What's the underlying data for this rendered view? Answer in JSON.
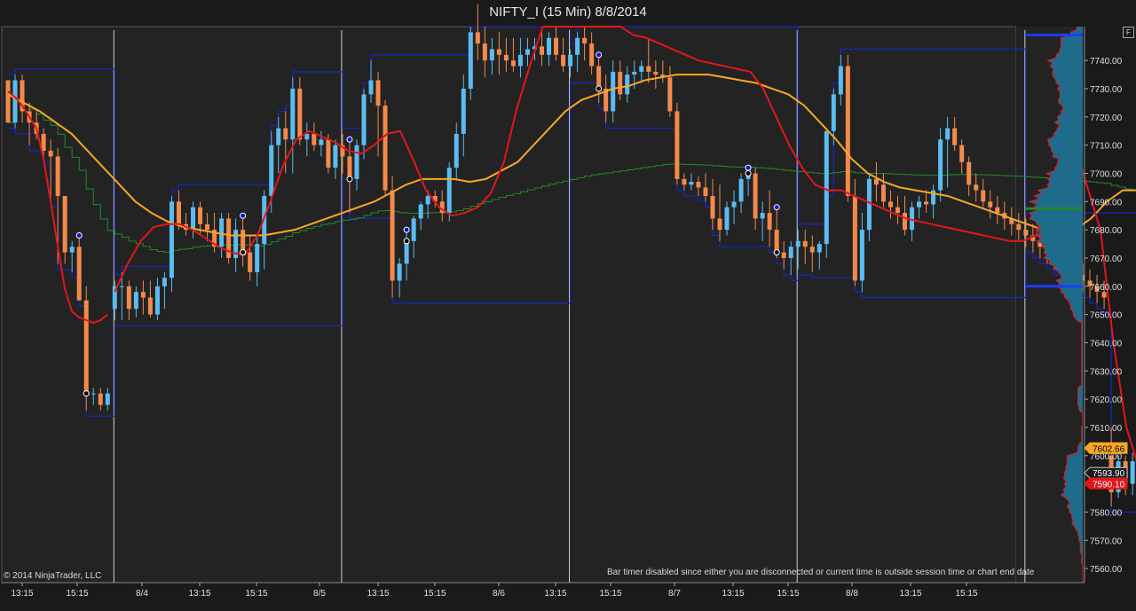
{
  "title": "NIFTY_I (15 Min)  8/8/2014",
  "f_button": "F",
  "copyright": "© 2014 NinjaTrader, LLC",
  "bar_timer_msg": "Bar timer disabled since either you are disconnected or current time is outside session time or chart end date",
  "colors": {
    "background": "#232323",
    "up_candle": "#5cbcf2",
    "down_candle": "#f48a4a",
    "ema_fast": "#e3161b",
    "ema_slow": "#f7a823",
    "vwap": "#1f8c28",
    "channel": "#1727b6",
    "session_line": "#ffffff",
    "profile": "#1f6b8c",
    "profile_edge": "#e3161b"
  },
  "chart_data": {
    "type": "candlestick",
    "title": "NIFTY_I (15 Min)  8/8/2014",
    "ylim": [
      7555,
      7752
    ],
    "y_ticks": [
      "7740.00",
      "7730.00",
      "7720.00",
      "7710.00",
      "7700.00",
      "7690.00",
      "7680.00",
      "7670.00",
      "7660.00",
      "7650.00",
      "7640.00",
      "7630.00",
      "7620.00",
      "7610.00",
      "7600.00",
      "7590.00",
      "7580.00",
      "7570.00",
      "7560.00"
    ],
    "x_ticks": [
      "13:15",
      "15:15",
      "8/4",
      "13:15",
      "15:15",
      "8/5",
      "13:15",
      "15:15",
      "8/6",
      "13:15",
      "15:15",
      "8/7",
      "13:15",
      "15:15",
      "8/8",
      "13:15",
      "15:15"
    ],
    "price_labels": [
      {
        "text": "7602.66",
        "value": 7602.66,
        "color": "#f7a823"
      },
      {
        "text": "7593.90",
        "value": 7593.9,
        "color": "#1a1a1a"
      },
      {
        "text": "7590.10",
        "value": 7590.1,
        "color": "#e3161b"
      }
    ],
    "session_starts": [
      15,
      47,
      79,
      111,
      143
    ],
    "candles": [
      [
        7733,
        7733,
        7718,
        7718
      ],
      [
        7718,
        7735,
        7716,
        7733
      ],
      [
        7733,
        7735,
        7718,
        7722
      ],
      [
        7722,
        7725,
        7710,
        7718
      ],
      [
        7718,
        7722,
        7712,
        7714
      ],
      [
        7714,
        7716,
        7706,
        7708
      ],
      [
        7708,
        7712,
        7690,
        7706
      ],
      [
        7706,
        7709,
        7668,
        7692
      ],
      [
        7692,
        7692,
        7668,
        7672
      ],
      [
        7672,
        7676,
        7665,
        7674
      ],
      [
        7674,
        7678,
        7655,
        7655
      ],
      [
        7655,
        7660,
        7616,
        7622
      ],
      [
        7622,
        7624,
        7618,
        7622
      ],
      [
        7622,
        7624,
        7616,
        7618
      ],
      [
        7618,
        7624,
        7616,
        7622
      ],
      [
        7652,
        7662,
        7648,
        7660
      ],
      [
        7660,
        7665,
        7648,
        7660
      ],
      [
        7660,
        7662,
        7648,
        7652
      ],
      [
        7652,
        7660,
        7649,
        7658
      ],
      [
        7658,
        7662,
        7650,
        7656
      ],
      [
        7656,
        7662,
        7649,
        7650
      ],
      [
        7650,
        7663,
        7648,
        7660
      ],
      [
        7660,
        7665,
        7652,
        7663
      ],
      [
        7663,
        7692,
        7658,
        7690
      ],
      [
        7690,
        7694,
        7680,
        7682
      ],
      [
        7682,
        7686,
        7678,
        7680
      ],
      [
        7680,
        7690,
        7677,
        7688
      ],
      [
        7688,
        7690,
        7678,
        7682
      ],
      [
        7682,
        7686,
        7676,
        7680
      ],
      [
        7680,
        7686,
        7672,
        7674
      ],
      [
        7674,
        7686,
        7670,
        7684
      ],
      [
        7684,
        7686,
        7668,
        7670
      ],
      [
        7670,
        7684,
        7665,
        7680
      ],
      [
        7680,
        7685,
        7667,
        7672
      ],
      [
        7672,
        7678,
        7662,
        7665
      ],
      [
        7665,
        7678,
        7660,
        7675
      ],
      [
        7675,
        7694,
        7666,
        7692
      ],
      [
        7692,
        7715,
        7686,
        7710
      ],
      [
        7710,
        7720,
        7700,
        7716
      ],
      [
        7716,
        7722,
        7700,
        7712
      ],
      [
        7712,
        7734,
        7700,
        7730
      ],
      [
        7730,
        7734,
        7710,
        7712
      ],
      [
        7712,
        7718,
        7706,
        7714
      ],
      [
        7714,
        7718,
        7708,
        7710
      ],
      [
        7710,
        7715,
        7706,
        7712
      ],
      [
        7712,
        7714,
        7700,
        7702
      ],
      [
        7702,
        7712,
        7698,
        7710
      ],
      [
        7710,
        7714,
        7700,
        7706
      ],
      [
        7706,
        7712,
        7686,
        7698
      ],
      [
        7698,
        7712,
        7694,
        7710
      ],
      [
        7710,
        7730,
        7705,
        7728
      ],
      [
        7728,
        7740,
        7725,
        7733
      ],
      [
        7733,
        7736,
        7706,
        7724
      ],
      [
        7724,
        7726,
        7692,
        7694
      ],
      [
        7694,
        7699,
        7656,
        7662
      ],
      [
        7662,
        7670,
        7656,
        7668
      ],
      [
        7668,
        7680,
        7662,
        7676
      ],
      [
        7676,
        7685,
        7670,
        7684
      ],
      [
        7684,
        7690,
        7680,
        7689
      ],
      [
        7689,
        7694,
        7684,
        7692
      ],
      [
        7692,
        7694,
        7688,
        7690
      ],
      [
        7690,
        7694,
        7683,
        7686
      ],
      [
        7686,
        7704,
        7683,
        7702
      ],
      [
        7702,
        7718,
        7698,
        7714
      ],
      [
        7714,
        7735,
        7706,
        7730
      ],
      [
        7730,
        7752,
        7726,
        7750
      ],
      [
        7750,
        7760,
        7740,
        7746
      ],
      [
        7746,
        7752,
        7734,
        7740
      ],
      [
        7740,
        7748,
        7735,
        7744
      ],
      [
        7744,
        7750,
        7735,
        7742
      ],
      [
        7742,
        7748,
        7736,
        7740
      ],
      [
        7740,
        7748,
        7736,
        7738
      ],
      [
        7738,
        7748,
        7734,
        7742
      ],
      [
        7742,
        7748,
        7738,
        7744
      ],
      [
        7744,
        7748,
        7740,
        7745
      ],
      [
        7745,
        7750,
        7738,
        7742
      ],
      [
        7742,
        7750,
        7738,
        7748
      ],
      [
        7748,
        7752,
        7740,
        7742
      ],
      [
        7742,
        7748,
        7736,
        7738
      ],
      [
        7738,
        7744,
        7734,
        7742
      ],
      [
        7742,
        7750,
        7736,
        7748
      ],
      [
        7748,
        7752,
        7740,
        7746
      ],
      [
        7746,
        7750,
        7735,
        7738
      ],
      [
        7738,
        7742,
        7725,
        7730
      ],
      [
        7730,
        7735,
        7718,
        7722
      ],
      [
        7722,
        7740,
        7718,
        7736
      ],
      [
        7736,
        7740,
        7726,
        7728
      ],
      [
        7728,
        7738,
        7725,
        7735
      ],
      [
        7735,
        7740,
        7730,
        7736
      ],
      [
        7736,
        7740,
        7732,
        7738
      ],
      [
        7738,
        7748,
        7732,
        7736
      ],
      [
        7736,
        7740,
        7730,
        7735
      ],
      [
        7735,
        7740,
        7732,
        7734
      ],
      [
        7734,
        7738,
        7720,
        7722
      ],
      [
        7722,
        7725,
        7696,
        7698
      ],
      [
        7698,
        7700,
        7694,
        7696
      ],
      [
        7696,
        7700,
        7694,
        7697
      ],
      [
        7697,
        7699,
        7692,
        7695
      ],
      [
        7695,
        7700,
        7690,
        7692
      ],
      [
        7692,
        7698,
        7680,
        7684
      ],
      [
        7684,
        7696,
        7676,
        7680
      ],
      [
        7680,
        7690,
        7678,
        7688
      ],
      [
        7688,
        7694,
        7682,
        7690
      ],
      [
        7690,
        7700,
        7686,
        7698
      ],
      [
        7698,
        7702,
        7692,
        7700
      ],
      [
        7700,
        7702,
        7680,
        7684
      ],
      [
        7684,
        7690,
        7676,
        7686
      ],
      [
        7686,
        7694,
        7674,
        7680
      ],
      [
        7680,
        7688,
        7670,
        7672
      ],
      [
        7672,
        7676,
        7666,
        7670
      ],
      [
        7670,
        7676,
        7664,
        7674
      ],
      [
        7674,
        7680,
        7666,
        7676
      ],
      [
        7676,
        7680,
        7668,
        7674
      ],
      [
        7674,
        7678,
        7665,
        7672
      ],
      [
        7672,
        7676,
        7666,
        7675
      ],
      [
        7675,
        7690,
        7670,
        7715
      ],
      [
        7715,
        7730,
        7710,
        7728
      ],
      [
        7728,
        7742,
        7724,
        7738
      ],
      [
        7738,
        7742,
        7690,
        7692
      ],
      [
        7692,
        7698,
        7660,
        7662
      ],
      [
        7662,
        7686,
        7658,
        7680
      ],
      [
        7680,
        7700,
        7676,
        7698
      ],
      [
        7698,
        7704,
        7690,
        7696
      ],
      [
        7696,
        7700,
        7688,
        7690
      ],
      [
        7690,
        7694,
        7684,
        7688
      ],
      [
        7688,
        7692,
        7682,
        7686
      ],
      [
        7686,
        7692,
        7678,
        7680
      ],
      [
        7680,
        7690,
        7676,
        7688
      ],
      [
        7688,
        7692,
        7684,
        7690
      ],
      [
        7690,
        7694,
        7686,
        7689
      ],
      [
        7689,
        7696,
        7684,
        7694
      ],
      [
        7694,
        7716,
        7690,
        7712
      ],
      [
        7712,
        7720,
        7695,
        7716
      ],
      [
        7716,
        7720,
        7708,
        7710
      ],
      [
        7710,
        7712,
        7700,
        7704
      ],
      [
        7704,
        7706,
        7692,
        7696
      ],
      [
        7696,
        7700,
        7690,
        7694
      ],
      [
        7694,
        7698,
        7688,
        7690
      ],
      [
        7690,
        7694,
        7684,
        7688
      ],
      [
        7688,
        7692,
        7682,
        7686
      ],
      [
        7686,
        7690,
        7680,
        7684
      ],
      [
        7684,
        7688,
        7678,
        7682
      ],
      [
        7682,
        7686,
        7676,
        7680
      ],
      [
        7680,
        7684,
        7674,
        7678
      ],
      [
        7678,
        7682,
        7672,
        7676
      ],
      [
        7676,
        7680,
        7670,
        7674
      ],
      [
        7674,
        7678,
        7668,
        7672
      ],
      [
        7672,
        7676,
        7666,
        7670
      ],
      [
        7670,
        7674,
        7664,
        7668
      ],
      [
        7668,
        7672,
        7662,
        7666
      ],
      [
        7666,
        7670,
        7660,
        7664
      ],
      [
        7664,
        7668,
        7658,
        7662
      ],
      [
        7662,
        7666,
        7656,
        7660
      ],
      [
        7660,
        7664,
        7654,
        7658
      ],
      [
        7658,
        7662,
        7652,
        7656
      ],
      [
        7600,
        7610,
        7582,
        7587
      ],
      [
        7587,
        7600,
        7585,
        7598
      ],
      [
        7598,
        7600,
        7586,
        7590
      ],
      [
        7590,
        7601,
        7586,
        7598
      ],
      [
        7598,
        7600,
        7584,
        7588
      ],
      [
        7588,
        7600,
        7586,
        7598
      ],
      [
        7598,
        7604,
        7592,
        7595
      ],
      [
        7595,
        7603,
        7590,
        7600
      ],
      [
        7600,
        7604,
        7592,
        7596
      ],
      [
        7596,
        7600,
        7585,
        7588
      ],
      [
        7588,
        7592,
        7576,
        7580
      ],
      [
        7580,
        7588,
        7575,
        7584
      ],
      [
        7584,
        7590,
        7578,
        7582
      ],
      [
        7582,
        7586,
        7574,
        7577
      ],
      [
        7577,
        7582,
        7572,
        7580
      ],
      [
        7580,
        7586,
        7574,
        7584
      ],
      [
        7584,
        7588,
        7576,
        7578
      ],
      [
        7578,
        7582,
        7566,
        7570
      ],
      [
        7570,
        7576,
        7562,
        7574
      ],
      [
        7574,
        7586,
        7570,
        7584
      ],
      [
        7584,
        7594,
        7580,
        7592
      ],
      [
        7592,
        7600,
        7588,
        7596
      ],
      [
        7596,
        7600,
        7582,
        7586
      ],
      [
        7586,
        7596,
        7580,
        7594
      ],
      [
        7594,
        7600,
        7586,
        7590
      ]
    ],
    "ema_fast": [
      [
        7729,
        7727,
        7724,
        7720,
        7716,
        7705,
        7690,
        7674,
        7659,
        7651,
        7649,
        7648,
        7647,
        7648,
        7650
      ],
      [
        7658,
        7668,
        7676,
        7681,
        7682,
        7682,
        7680,
        7677,
        7674,
        7672,
        7671,
        7678,
        7690,
        7703,
        7712,
        7715,
        7713,
        7711,
        7708,
        7707,
        7710,
        7714,
        7715,
        7705,
        7694,
        7688,
        7685,
        7686,
        7688,
        7693,
        7704,
        7723,
        7738,
        7760,
        7775,
        7772,
        7765,
        7760,
        7756,
        7753,
        7749,
        7748,
        7746,
        7744,
        7742,
        7740,
        7739,
        7738,
        7737,
        7736,
        7730,
        7720,
        7710,
        7702,
        7696,
        7694,
        7694,
        7692,
        7690,
        7688,
        7686,
        7684,
        7683,
        7682,
        7681,
        7680,
        7679,
        7678,
        7677,
        7676,
        7676,
        7678,
        7690,
        7708,
        7710,
        7695,
        7680,
        7640,
        7610,
        7595,
        7590,
        7586,
        7584,
        7582,
        7580,
        7578,
        7577,
        7578,
        7582,
        7586,
        7588
      ]
    ],
    "ema_slow": [
      7728,
      7725,
      7722,
      7718,
      7714,
      7708,
      7702,
      7696,
      7690,
      7686,
      7683,
      7681,
      7680,
      7679,
      7678,
      7678,
      7678,
      7679,
      7680,
      7682,
      7684,
      7686,
      7688,
      7690,
      7693,
      7696,
      7698,
      7698,
      7698,
      7697,
      7698,
      7701,
      7704,
      7710,
      7716,
      7722,
      7726,
      7728,
      7730,
      7731,
      7733,
      7734,
      7735,
      7735,
      7735,
      7734,
      7733,
      7732,
      7730,
      7728,
      7724,
      7718,
      7712,
      7705,
      7700,
      7697,
      7695,
      7694,
      7693,
      7692,
      7690,
      7688,
      7686,
      7684,
      7682,
      7680,
      7679,
      7680,
      7684,
      7690,
      7694,
      7694,
      7692,
      7680,
      7665,
      7650,
      7636,
      7624,
      7614,
      7606,
      7602.66
    ]
  }
}
